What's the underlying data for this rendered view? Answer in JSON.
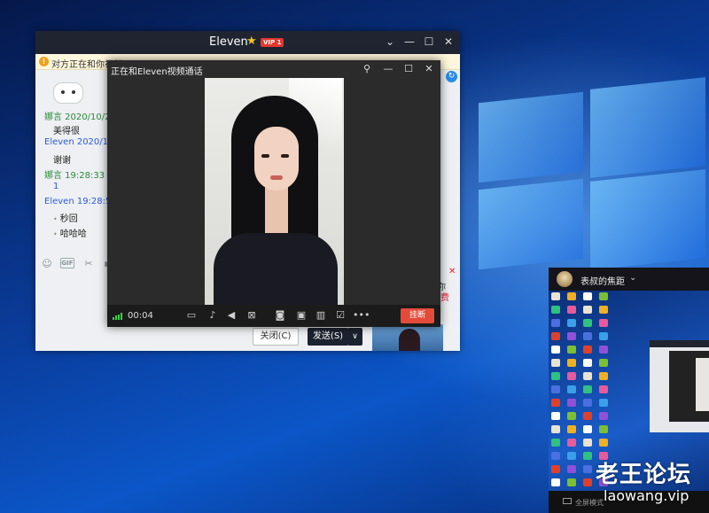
{
  "chat_window": {
    "title": "Eleven",
    "vip_badge": "VIP 1",
    "notice": "对方正在和你视频",
    "messages": [
      {
        "sender": "娜言 2020/10/22",
        "text": "美得很"
      },
      {
        "sender": "Eleven 2020/10/2",
        "text": "谢谢"
      },
      {
        "sender": "娜言  19:28:33",
        "text": "1"
      },
      {
        "sender": "Eleven  19:28:59",
        "text": "秒回"
      },
      {
        "sender": "",
        "text": "哈哈哈"
      }
    ],
    "toolbar_gif": "GIF",
    "ad_close": "✕",
    "ad_text1": "你",
    "ad_text2": "费",
    "close_button": "关闭(C)",
    "send_button": "发送(S)",
    "send_dropdown": "∨"
  },
  "video_window": {
    "title": "正在和Eleven视频通话",
    "timer": "00:04",
    "hangup_label": "挂断"
  },
  "share_window": {
    "title": "表叔的焦距",
    "footer": "全屏模式"
  },
  "watermark": {
    "line1": "老王论坛",
    "line2": "laowang.vip"
  },
  "colors": {
    "accent_red": "#e44b3a",
    "signal_green": "#3bd14a",
    "chat_sender_green": "#2a8b3a",
    "chat_sender_blue": "#2a5bd7"
  }
}
